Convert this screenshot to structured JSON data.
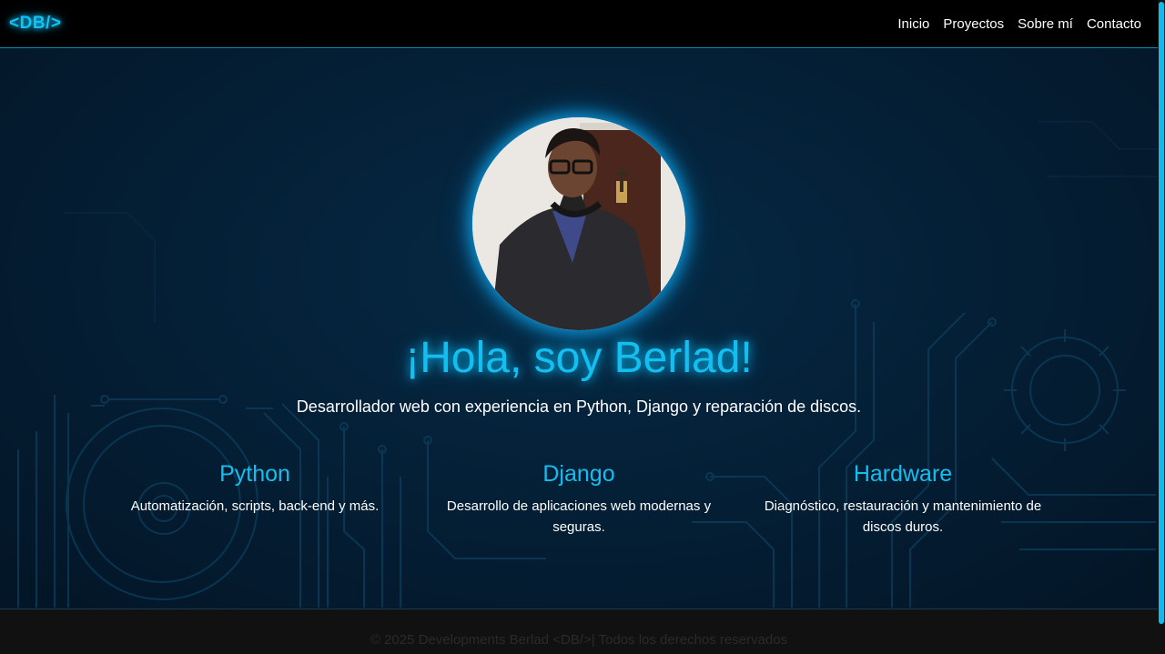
{
  "nav": {
    "logo": "<DB/>",
    "links": [
      "Inicio",
      "Proyectos",
      "Sobre mí",
      "Contacto"
    ]
  },
  "hero": {
    "title": "¡Hola, soy Berlad!",
    "subtitle": "Desarrollador web con experiencia en Python, Django y reparación de discos."
  },
  "skills": [
    {
      "title": "Python",
      "description": "Automatización, scripts, back-end y más."
    },
    {
      "title": "Django",
      "description": "Desarrollo de aplicaciones web modernas y seguras."
    },
    {
      "title": "Hardware",
      "description": "Diagnóstico, restauración y mantenimiento de discos duros."
    }
  ],
  "footer": {
    "text": "© 2025 Developments Berlad <DB/>| Todos los derechos reservados"
  },
  "colors": {
    "accent": "#13bff0",
    "nav_bg": "#000000",
    "hero_bg": "#041e34",
    "footer_bg": "#111111"
  }
}
